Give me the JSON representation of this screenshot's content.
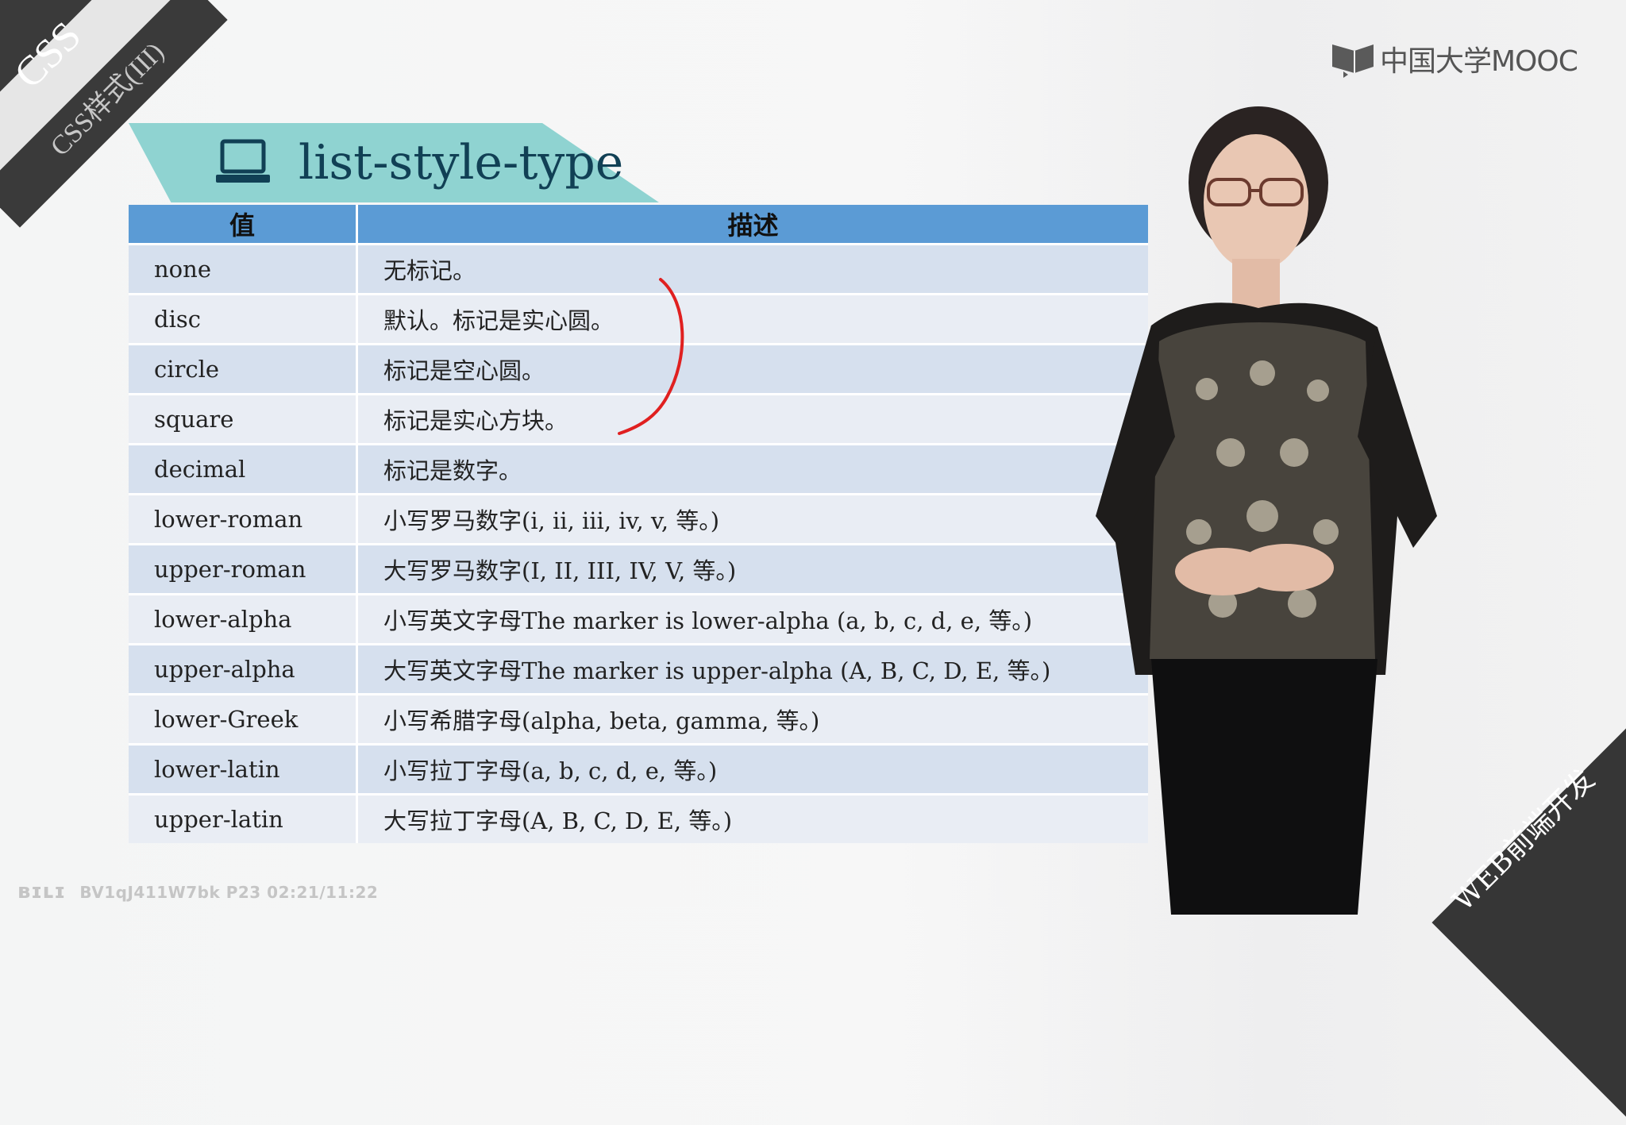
{
  "corner": {
    "title": "CSS",
    "subtitle": "CSS样式(III)"
  },
  "logo": {
    "text": "中国大学MOOC"
  },
  "slide": {
    "heading": "list-style-type",
    "table": {
      "headers": [
        "值",
        "描述"
      ],
      "rows": [
        {
          "value": "none",
          "desc": "无标记。"
        },
        {
          "value": "disc",
          "desc": "默认。标记是实心圆。"
        },
        {
          "value": "circle",
          "desc": "标记是空心圆。"
        },
        {
          "value": "square",
          "desc": "标记是实心方块。"
        },
        {
          "value": "decimal",
          "desc": "标记是数字。"
        },
        {
          "value": "lower-roman",
          "desc": "小写罗马数字(i, ii, iii, iv, v, 等。)"
        },
        {
          "value": "upper-roman",
          "desc": "大写罗马数字(I, II, III, IV, V, 等。)"
        },
        {
          "value": "lower-alpha",
          "desc": "小写英文字母The marker is lower-alpha (a, b, c, d, e, 等。)"
        },
        {
          "value": "upper-alpha",
          "desc": "大写英文字母The marker is upper-alpha (A, B, C, D, E, 等。)"
        },
        {
          "value": "lower-Greek",
          "desc": "小写希腊字母(alpha, beta, gamma, 等。)"
        },
        {
          "value": "lower-latin",
          "desc": "小写拉丁字母(a, b, c, d, e, 等。)"
        },
        {
          "value": "upper-latin",
          "desc": "大写拉丁字母(A, B, C, D, E, 等。)"
        }
      ]
    }
  },
  "footer": {
    "course_tag": "WEB前端开发",
    "watermark": "BV1qJ411W7bk P23 02:21/11:22"
  },
  "colors": {
    "banner": "#8fd3d1",
    "header": "#5b9bd5",
    "row_odd": "#d6e0ee",
    "row_even": "#e9edf4",
    "annotation": "#e02020"
  },
  "icons": [
    "laptop-icon",
    "mooc-logo-icon",
    "bilibili-logo-icon"
  ]
}
